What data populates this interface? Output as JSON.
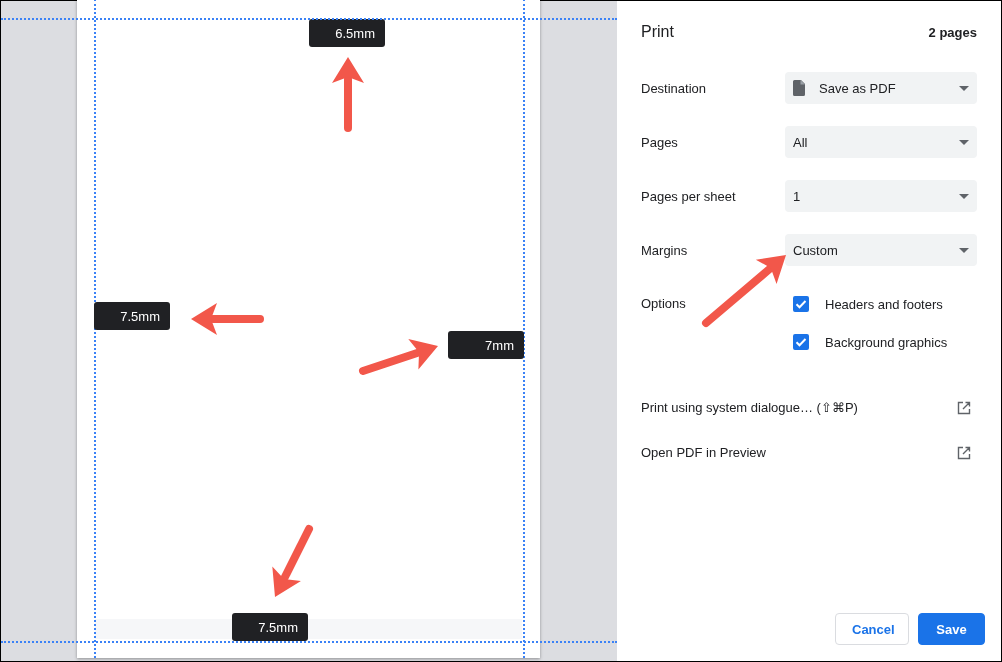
{
  "preview": {
    "margins": [
      {
        "kind": "top",
        "value": "6.5mm"
      },
      {
        "kind": "left",
        "value": "7.5mm"
      },
      {
        "kind": "right",
        "value": "7mm"
      },
      {
        "kind": "bottom",
        "value": "7.5mm"
      }
    ]
  },
  "panel": {
    "title": "Print",
    "page_count": "2 pages",
    "settings": [
      {
        "kind": "select",
        "label": "Destination",
        "value": "Save as PDF",
        "file_icon": true
      },
      {
        "kind": "select",
        "label": "Pages",
        "value": "All",
        "file_icon": false
      },
      {
        "kind": "select",
        "label": "Pages per sheet",
        "value": "1",
        "file_icon": false
      },
      {
        "kind": "select",
        "label": "Margins",
        "value": "Custom",
        "file_icon": false
      },
      {
        "kind": "checkboxes",
        "label": "Options",
        "options": [
          {
            "label": "Headers and footers",
            "checked": true
          },
          {
            "label": "Background graphics",
            "checked": true
          }
        ]
      }
    ],
    "links": [
      "Print using system dialogue… (⇧⌘P)",
      "Open PDF in Preview"
    ],
    "buttons": [
      {
        "kind": "secondary",
        "label": "Cancel"
      },
      {
        "kind": "primary",
        "label": "Save"
      }
    ]
  }
}
